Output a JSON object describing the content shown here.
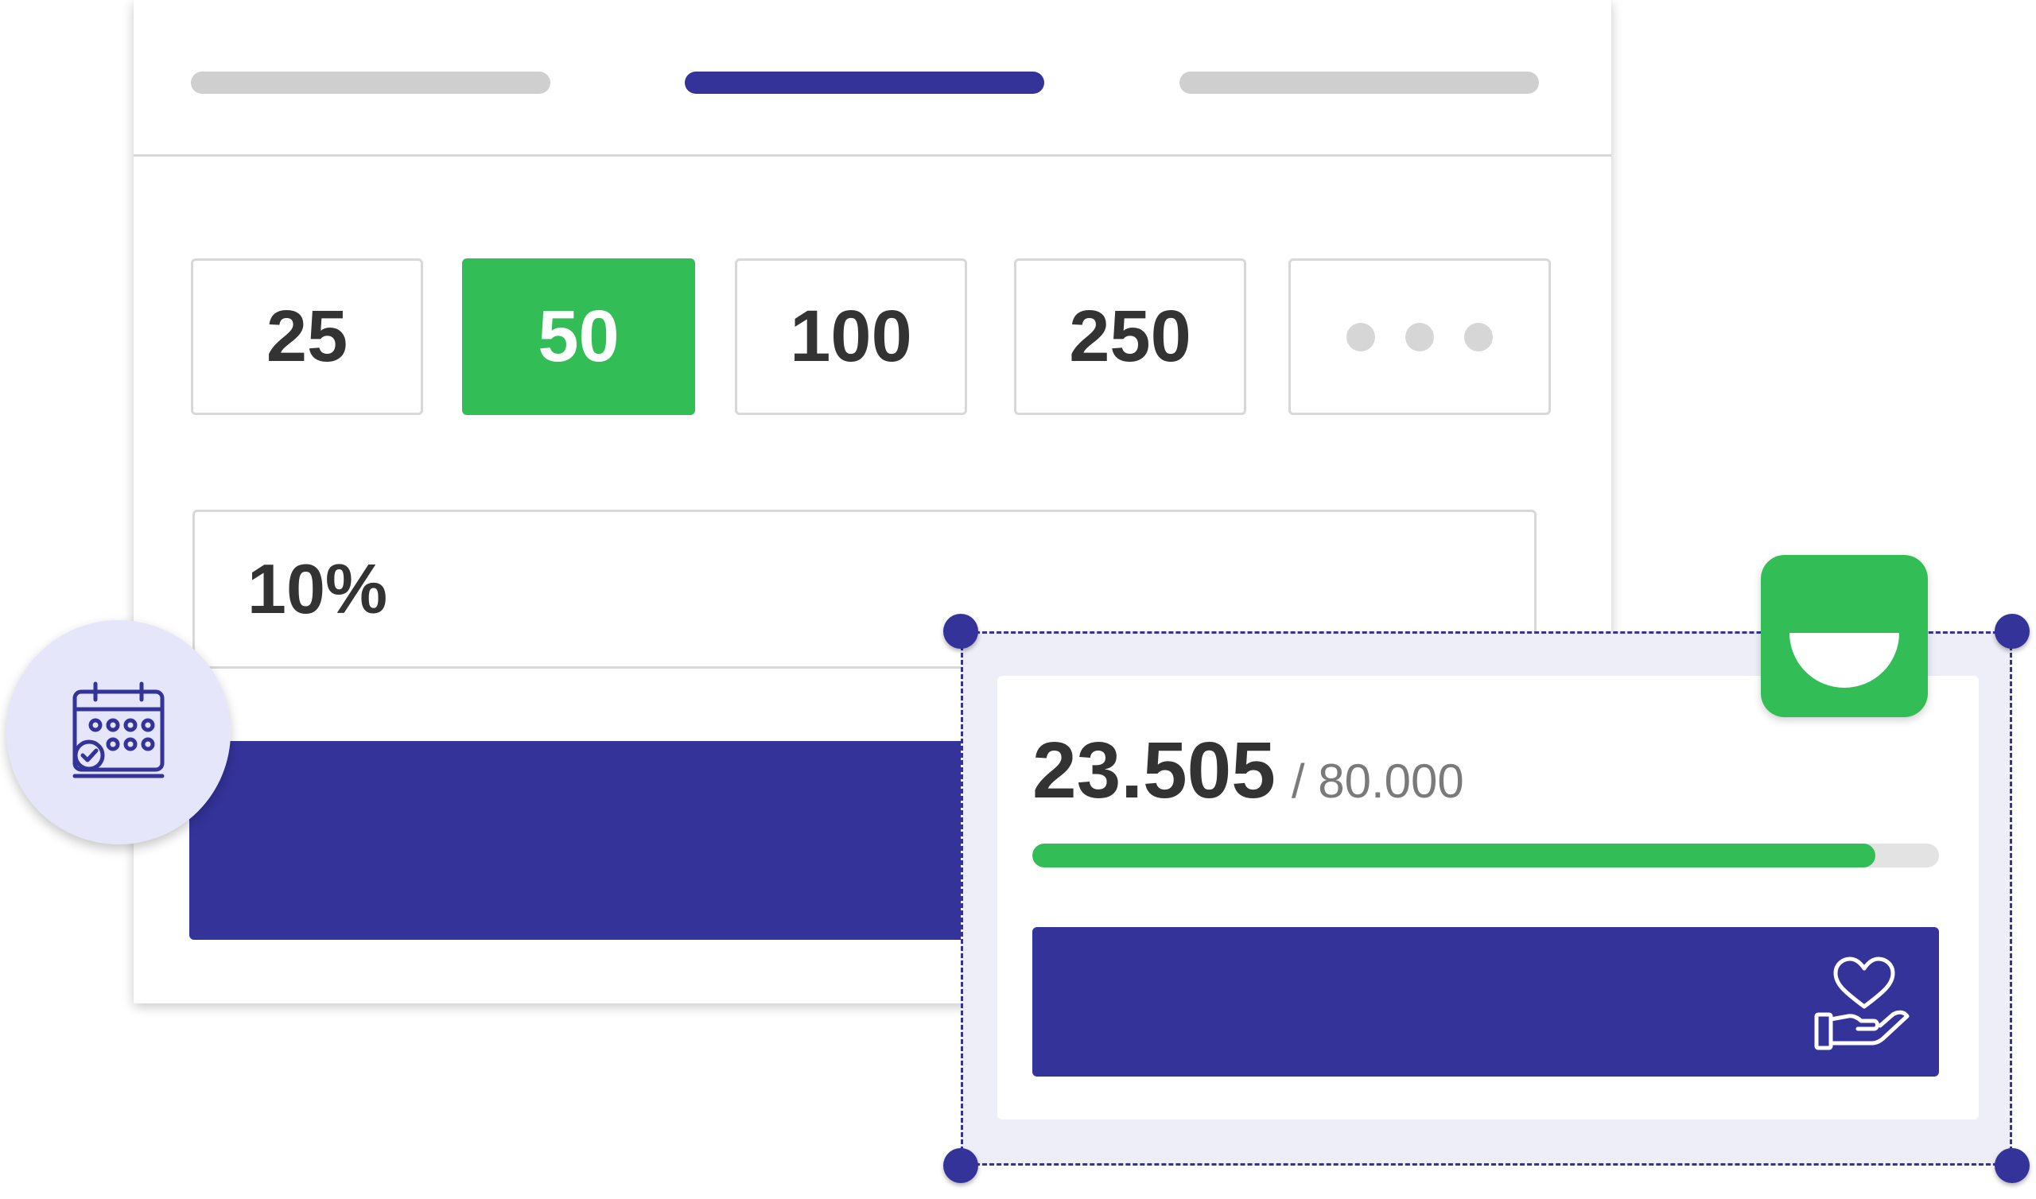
{
  "steps": [
    {
      "state": "inactive"
    },
    {
      "state": "active"
    },
    {
      "state": "inactive"
    }
  ],
  "amounts": [
    {
      "label": "25",
      "selected": false
    },
    {
      "label": "50",
      "selected": true
    },
    {
      "label": "100",
      "selected": false
    },
    {
      "label": "250",
      "selected": false
    }
  ],
  "more_amounts_icon": "more-dots-icon",
  "percent_field": {
    "value": "10%"
  },
  "progress": {
    "raised": "23.505",
    "goal": "/ 80.000",
    "fill_fraction": 0.93
  },
  "icons": {
    "calendar": "calendar-check-icon",
    "donate": "heart-hand-icon",
    "brand": "smile-logo-icon"
  },
  "colors": {
    "primary": "#34339a",
    "accent_green": "#32bd57",
    "badge_bg": "#e6e6fa",
    "muted": "#cfcfcf"
  }
}
